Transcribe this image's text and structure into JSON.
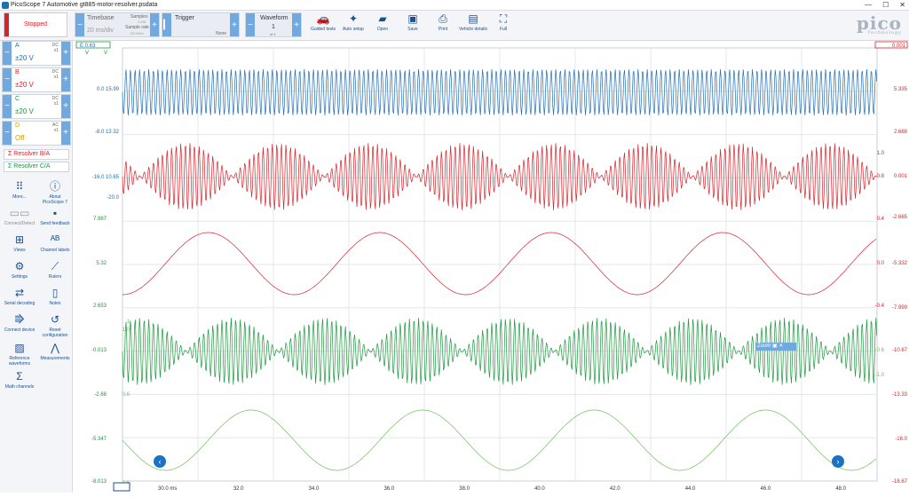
{
  "window": {
    "title": "PicoScope 7 Automotive gt885-motor-resolver.psdata",
    "minimize": "—",
    "maximize": "☐",
    "close": "✕"
  },
  "toolbar": {
    "status": "Stopped",
    "timebase_label": "Timebase",
    "timebase_value": "20 ms/div",
    "samples_label": "Samples",
    "samples_value": "1 MS",
    "sample_rate_label": "Sample rate",
    "sample_rate_value": "25 MS/s",
    "trigger_label": "Trigger",
    "trigger_value": "None",
    "waveform_label": "Waveform",
    "waveform_value": "1",
    "waveform_of": "of 1",
    "buttons": [
      {
        "label": "Guided tests",
        "icon": "car-icon"
      },
      {
        "label": "Auto setup",
        "icon": "wand-icon"
      },
      {
        "label": "Open",
        "icon": "folder-icon"
      },
      {
        "label": "Save",
        "icon": "save-icon"
      },
      {
        "label": "Print",
        "icon": "print-icon"
      },
      {
        "label": "Vehicle details",
        "icon": "clipboard-icon"
      },
      {
        "label": "Full",
        "icon": "fullscreen-icon"
      }
    ],
    "brand": "pico",
    "brand_sub": "Technology"
  },
  "channels": [
    {
      "name": "A",
      "range": "±20 V",
      "coupling": "DC",
      "probe": "x1",
      "color": "#1f6fb6"
    },
    {
      "name": "B",
      "range": "±20 V",
      "coupling": "DC",
      "probe": "x1",
      "color": "#d8232a"
    },
    {
      "name": "C",
      "range": "±20 V",
      "coupling": "DC",
      "probe": "x1",
      "color": "#1a9a3c"
    },
    {
      "name": "D",
      "range": "Off",
      "coupling": "AC",
      "probe": "x1",
      "color": "#d8a000"
    }
  ],
  "math_channels": [
    {
      "name": "Resolver B/A",
      "color": "#d8232a"
    },
    {
      "name": "Resolver C/A",
      "color": "#1a9a3c"
    }
  ],
  "tools": [
    {
      "label": "More...",
      "icon": "grid-icon"
    },
    {
      "label": "About PicoScope 7",
      "icon": "info-icon"
    },
    {
      "label": "Connect/Detect",
      "icon": "connect-icon"
    },
    {
      "label": "Send feedback",
      "icon": "feedback-icon"
    },
    {
      "label": "Views",
      "icon": "views-icon"
    },
    {
      "label": "Channel labels",
      "icon": "channel-labels-icon"
    },
    {
      "label": "Settings",
      "icon": "gear-icon"
    },
    {
      "label": "Rulers",
      "icon": "ruler-icon"
    },
    {
      "label": "Serial decoding",
      "icon": "serial-icon"
    },
    {
      "label": "Notes",
      "icon": "notes-icon"
    },
    {
      "label": "Connect device",
      "icon": "usb-icon"
    },
    {
      "label": "Reset configuration",
      "icon": "reset-icon"
    },
    {
      "label": "Reference waveforms",
      "icon": "reference-icon"
    },
    {
      "label": "Measurements",
      "icon": "measure-icon"
    },
    {
      "label": "Math channels",
      "icon": "sigma-icon"
    }
  ],
  "plot": {
    "x_ticks": [
      "30.0 ms",
      "32.0",
      "34.0",
      "36.0",
      "38.0",
      "40.0",
      "42.0",
      "44.0",
      "46.0",
      "48.0"
    ],
    "left_top_label": "E 0.63",
    "right_top_label": "0.001",
    "axis_a_unit": "V",
    "axis_b_unit": "V",
    "left_labels_blue": [
      "0.0 15.99",
      "-8.0 13.32",
      "-16.0 10.65",
      "-20.0"
    ],
    "left_labels_green": [
      "7.987",
      "5.32",
      "2.653",
      "-0.013",
      "-2.68",
      "-5.347",
      "-8.013"
    ],
    "right_labels_red": [
      "5.335",
      "2.668",
      "0.001",
      "-2.665",
      "-5.332",
      "-7.999",
      "-10.67",
      "-13.33",
      "-16.0",
      "-18.67"
    ],
    "inner_red_labels": [
      "1.0",
      "0.8",
      "0.4",
      "0.0",
      "-0.4"
    ],
    "inner_green_labels": [
      "1",
      "1.0",
      "0.6",
      "-0.6"
    ],
    "inner_right_green": [
      "-0.6",
      "-1.0"
    ],
    "zoom_label": "Zoom",
    "colors": {
      "a": "#1f6fb6",
      "b": "#d8232a",
      "c": "#1a9a3c",
      "grid": "#e3e7ed"
    }
  }
}
